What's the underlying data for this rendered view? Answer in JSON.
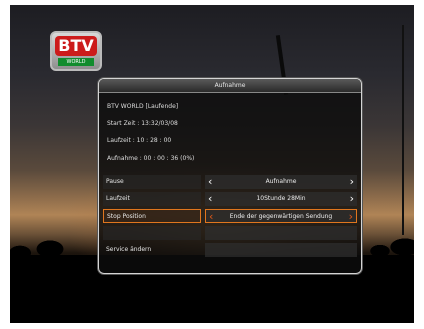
{
  "logo": {
    "main": "BTV",
    "sub": "WORLD"
  },
  "dialog": {
    "title": "Aufnahme",
    "channel_line": "BTV WORLD [Laufende]",
    "start_line": "Start Zeit : 13:32/03/08",
    "duration_line": "Laufzeit : 10 : 28 : 00",
    "recording_line": "Aufnahme : 00 : 00 : 36 (0%)",
    "rows": [
      {
        "label": "Pause",
        "value": "Aufnahme"
      },
      {
        "label": "Laufzeit",
        "value": "10Stunde 28Min"
      },
      {
        "label": "Stop Position",
        "value": "Ende der gegenwärtigen Sendung"
      }
    ],
    "service_label": "Service ändern"
  },
  "colors": {
    "highlight": "#e0761e",
    "arrow_selected": "#e35a1a"
  }
}
